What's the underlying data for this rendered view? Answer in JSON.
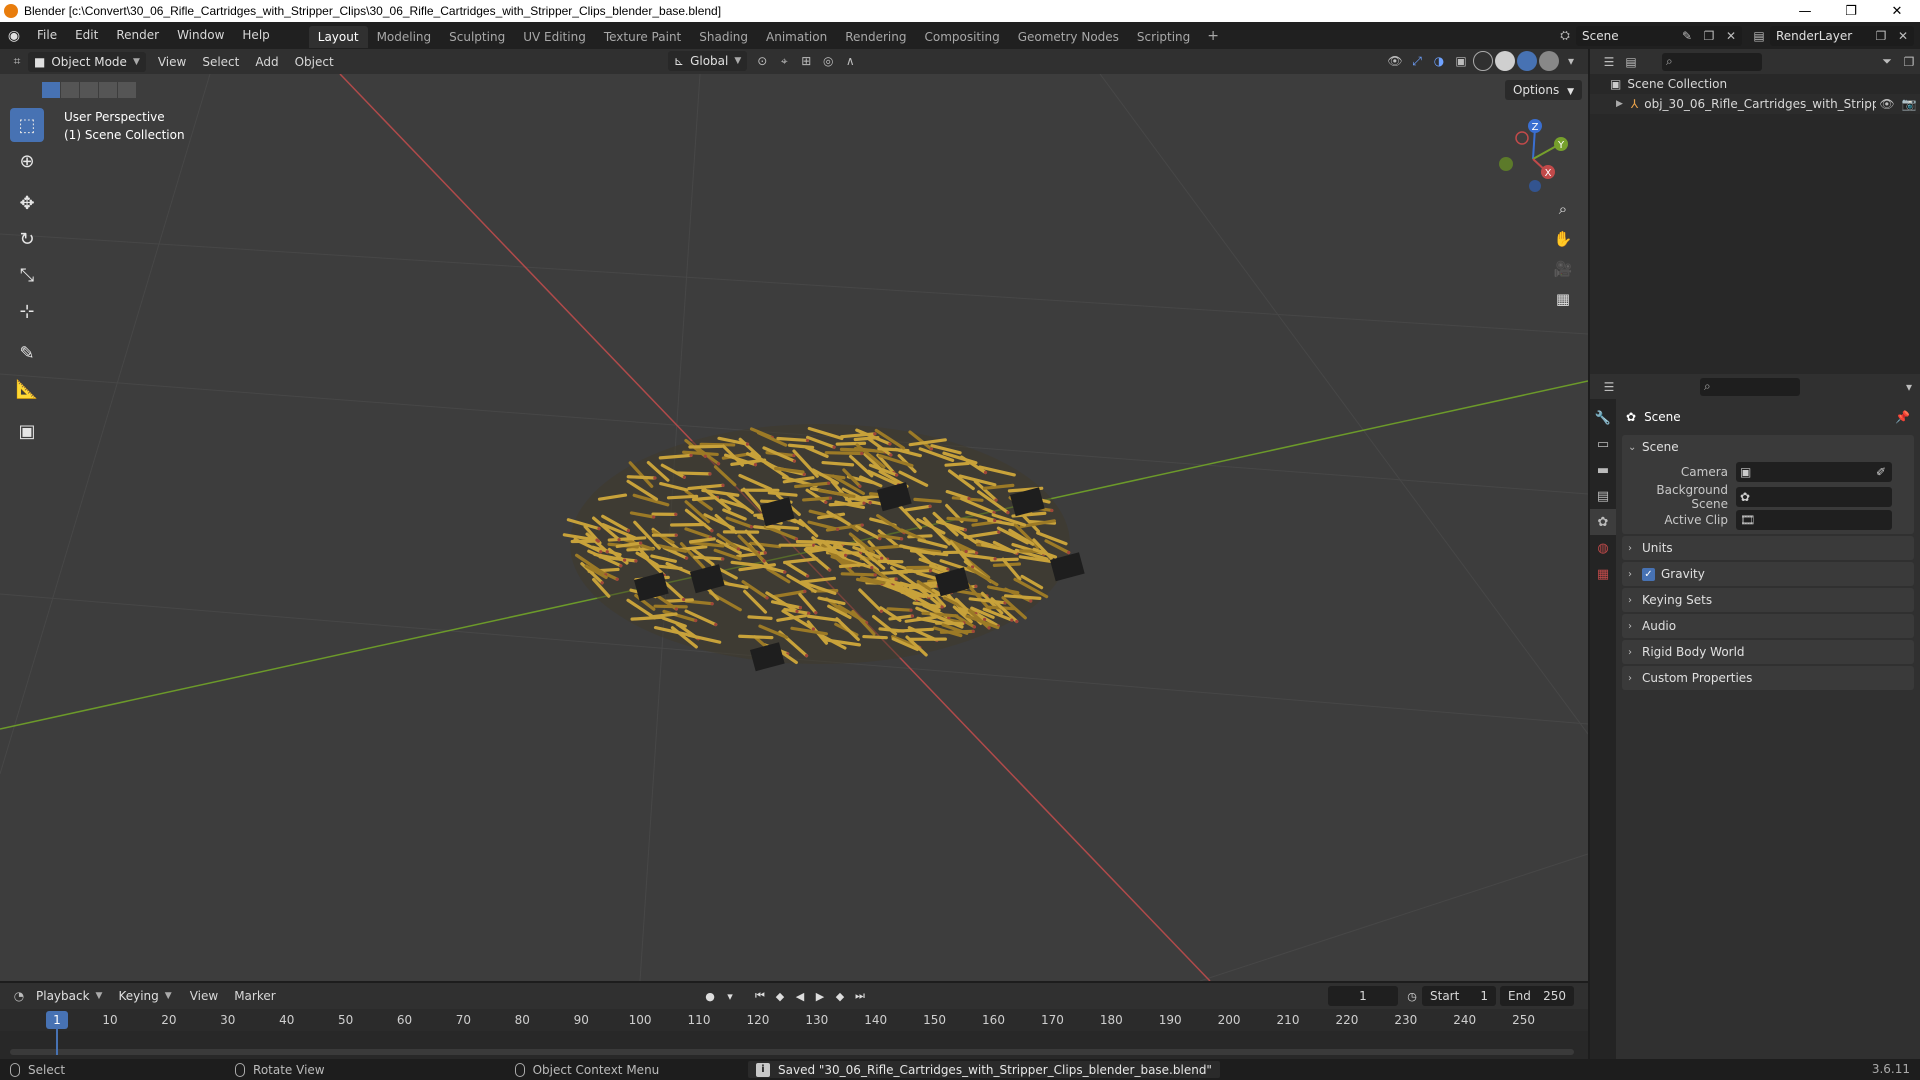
{
  "window": {
    "title": "Blender [c:\\Convert\\30_06_Rifle_Cartridges_with_Stripper_Clips\\30_06_Rifle_Cartridges_with_Stripper_Clips_blender_base.blend]",
    "minimize": "—",
    "maximize": "❐",
    "close": "✕"
  },
  "menu": {
    "items": [
      "File",
      "Edit",
      "Render",
      "Window",
      "Help"
    ],
    "workspaces": [
      "Layout",
      "Modeling",
      "Sculpting",
      "UV Editing",
      "Texture Paint",
      "Shading",
      "Animation",
      "Rendering",
      "Compositing",
      "Geometry Nodes",
      "Scripting"
    ],
    "active_workspace": "Layout",
    "add_workspace": "+",
    "scene_name": "Scene",
    "render_layer": "RenderLayer"
  },
  "viewport_header": {
    "mode": "Object Mode",
    "menus": [
      "View",
      "Select",
      "Add",
      "Object"
    ],
    "orientation": "Global",
    "options": "Options"
  },
  "viewport": {
    "perspective": "User Perspective",
    "collection": "(1) Scene Collection",
    "gizmo_labels": {
      "x": "X",
      "y": "Y",
      "z": "Z"
    }
  },
  "outliner": {
    "root": "Scene Collection",
    "object": "obj_30_06_Rifle_Cartridges_with_Stripp"
  },
  "properties": {
    "context": "Scene",
    "panel_scene": "Scene",
    "camera_label": "Camera",
    "background_scene_label": "Background Scene",
    "active_clip_label": "Active Clip",
    "panels": [
      "Units",
      "Gravity",
      "Keying Sets",
      "Audio",
      "Rigid Body World",
      "Custom Properties"
    ],
    "gravity_checked": true
  },
  "timeline": {
    "menus": [
      "Playback",
      "Keying",
      "View",
      "Marker"
    ],
    "current_frame": "1",
    "start_label": "Start",
    "start": "1",
    "end_label": "End",
    "end": "250",
    "ruler_numbers": [
      "1",
      "10",
      "20",
      "30",
      "40",
      "50",
      "60",
      "70",
      "80",
      "90",
      "100",
      "110",
      "120",
      "130",
      "140",
      "150",
      "160",
      "170",
      "180",
      "190",
      "200",
      "210",
      "220",
      "230",
      "240",
      "250"
    ]
  },
  "status": {
    "select": "Select",
    "rotate": "Rotate View",
    "context_menu": "Object Context Menu",
    "message": "Saved \"30_06_Rifle_Cartridges_with_Stripper_Clips_blender_base.blend\"",
    "version": "3.6.11"
  },
  "colors": {
    "accent": "#4772b3",
    "x_axis": "#c14a4a",
    "y_axis": "#76a02c",
    "brass": "#c8a23a"
  }
}
